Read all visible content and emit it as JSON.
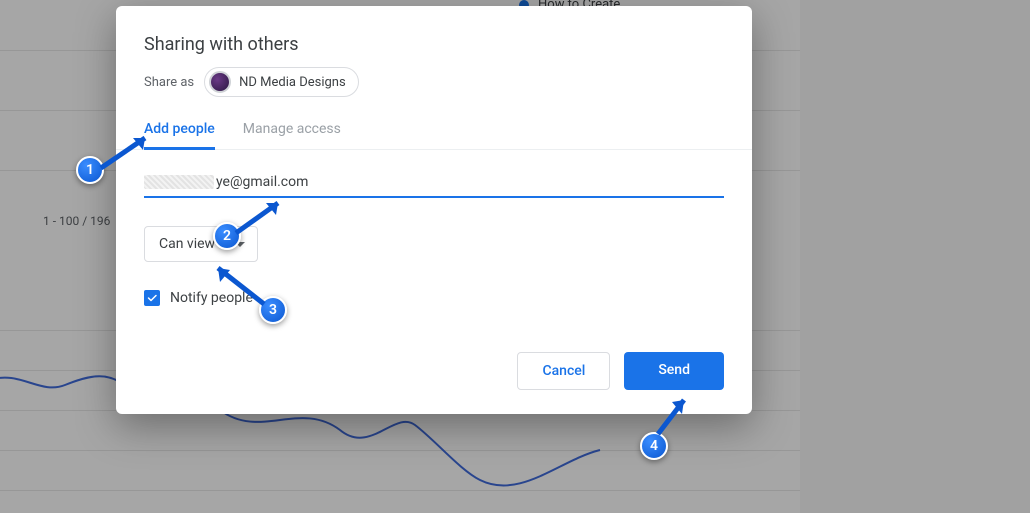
{
  "background": {
    "top_caption": "How to Create",
    "pagination": "1 - 100 / 196"
  },
  "dialog": {
    "title": "Sharing with others",
    "share_as_label": "Share as",
    "identity": "ND Media Designs",
    "tabs": {
      "add_people": "Add people",
      "manage_access": "Manage access"
    },
    "email_suffix": "ye@gmail.com",
    "permission": "Can view",
    "notify_label": "Notify people",
    "notify_checked": true,
    "actions": {
      "cancel": "Cancel",
      "send": "Send"
    }
  },
  "annotations": {
    "one": "1",
    "two": "2",
    "three": "3",
    "four": "4"
  }
}
